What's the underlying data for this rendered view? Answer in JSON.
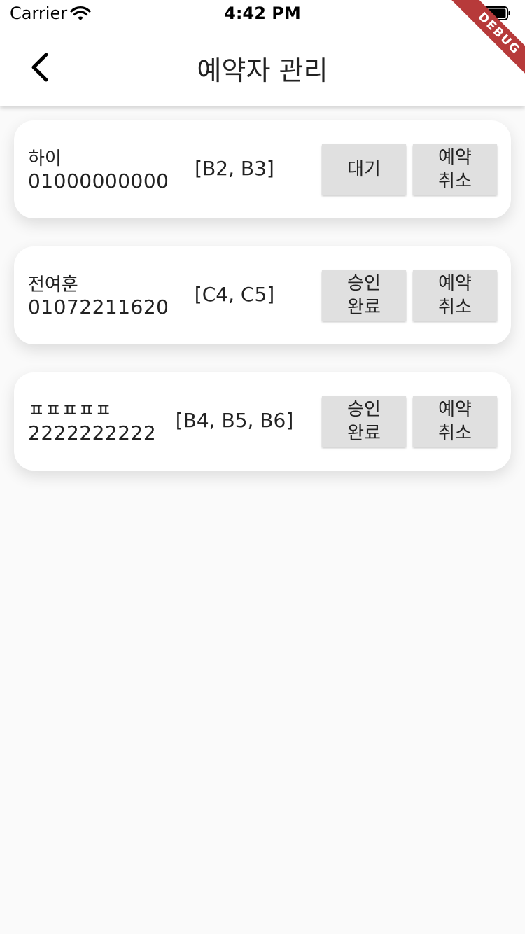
{
  "status_bar": {
    "carrier": "Carrier",
    "time": "4:42 PM"
  },
  "debug_banner": "DEBUG",
  "header": {
    "title": "예약자 관리",
    "back_icon": "chevron-left-icon"
  },
  "reservations": [
    {
      "name": "하이",
      "phone": "01000000000",
      "seats": "[B2, B3]",
      "status_label": "대기",
      "cancel_label": "예약\n취소"
    },
    {
      "name": "전여훈",
      "phone": "01072211620",
      "seats": "[C4, C5]",
      "status_label": "승인\n완료",
      "cancel_label": "예약\n취소"
    },
    {
      "name": "ㅍㅍㅍㅍㅍ",
      "phone": "2222222222",
      "seats": "[B4, B5, B6]",
      "status_label": "승인\n완료",
      "cancel_label": "예약\n취소"
    }
  ],
  "colors": {
    "background": "#fafafa",
    "card": "#ffffff",
    "button": "#e0e0e0",
    "debug_banner": "#b73a3a"
  }
}
